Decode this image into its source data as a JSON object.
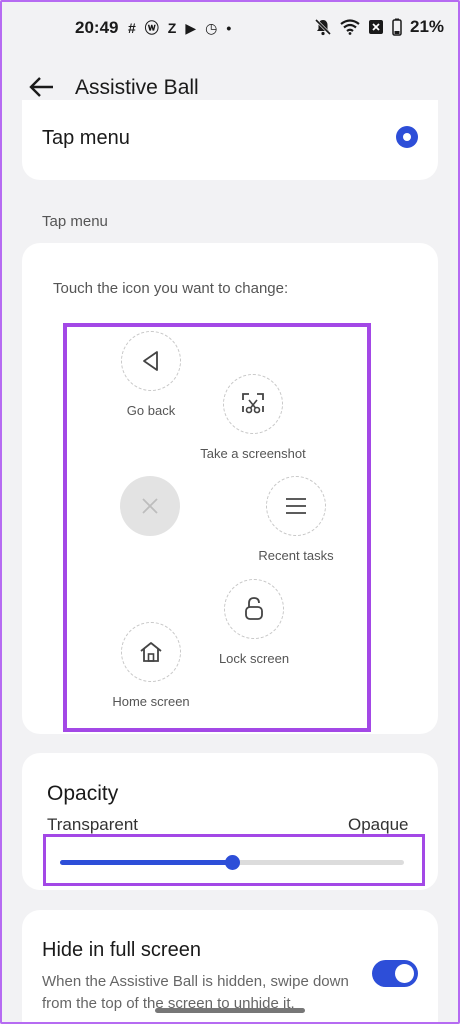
{
  "status_bar": {
    "time": "20:49",
    "left_icons": [
      "#",
      "ⓦ",
      "Z",
      "▶",
      "◷",
      "•"
    ],
    "battery": "21%"
  },
  "header": {
    "title": "Assistive Ball"
  },
  "tap_menu_card": {
    "label": "Tap menu",
    "selected": true
  },
  "section": {
    "label": "Tap menu"
  },
  "menu_card": {
    "hint": "Touch the icon you want to change:",
    "items": [
      {
        "label": "Go back",
        "icon": "triangle-back-icon"
      },
      {
        "label": "Take a screenshot",
        "icon": "screenshot-icon"
      },
      {
        "label": "Recent tasks",
        "icon": "menu-lines-icon"
      },
      {
        "label": "Lock screen",
        "icon": "lock-icon"
      },
      {
        "label": "Home screen",
        "icon": "home-icon"
      }
    ],
    "center_icon": "close-icon"
  },
  "opacity": {
    "title": "Opacity",
    "min_label": "Transparent",
    "max_label": "Opaque",
    "value": 0.5
  },
  "hide_fullscreen": {
    "title": "Hide in full screen",
    "description": "When the Assistive Ball is hidden, swipe down from the top of the screen to unhide it.",
    "enabled": true
  },
  "colors": {
    "accent": "#2d4ed8",
    "highlight": "#a348e6"
  }
}
